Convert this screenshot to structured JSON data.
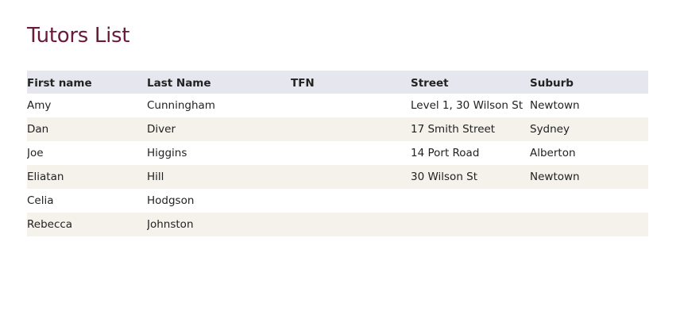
{
  "page": {
    "title": "Tutors List"
  },
  "table": {
    "headers": {
      "first_name": "First name",
      "last_name": "Last Name",
      "tfn": "TFN",
      "street": "Street",
      "suburb": "Suburb"
    },
    "rows": [
      {
        "first_name": "Amy",
        "last_name": "Cunningham",
        "tfn": "",
        "street": "Level 1, 30 Wilson St",
        "suburb": "Newtown"
      },
      {
        "first_name": "Dan",
        "last_name": "Diver",
        "tfn": "",
        "street": "17 Smith Street",
        "suburb": "Sydney"
      },
      {
        "first_name": "Joe",
        "last_name": "Higgins",
        "tfn": "",
        "street": "14 Port Road",
        "suburb": "Alberton"
      },
      {
        "first_name": "Eliatan",
        "last_name": "Hill",
        "tfn": "",
        "street": "30 Wilson St",
        "suburb": "Newtown"
      },
      {
        "first_name": "Celia",
        "last_name": "Hodgson",
        "tfn": "",
        "street": "",
        "suburb": ""
      },
      {
        "first_name": "Rebecca",
        "last_name": "Johnston",
        "tfn": "",
        "street": "",
        "suburb": ""
      }
    ]
  },
  "colors": {
    "title": "#6a1a3a",
    "header_background": "#e6e6ef",
    "alternate_row_background": "#f5f1eb"
  }
}
